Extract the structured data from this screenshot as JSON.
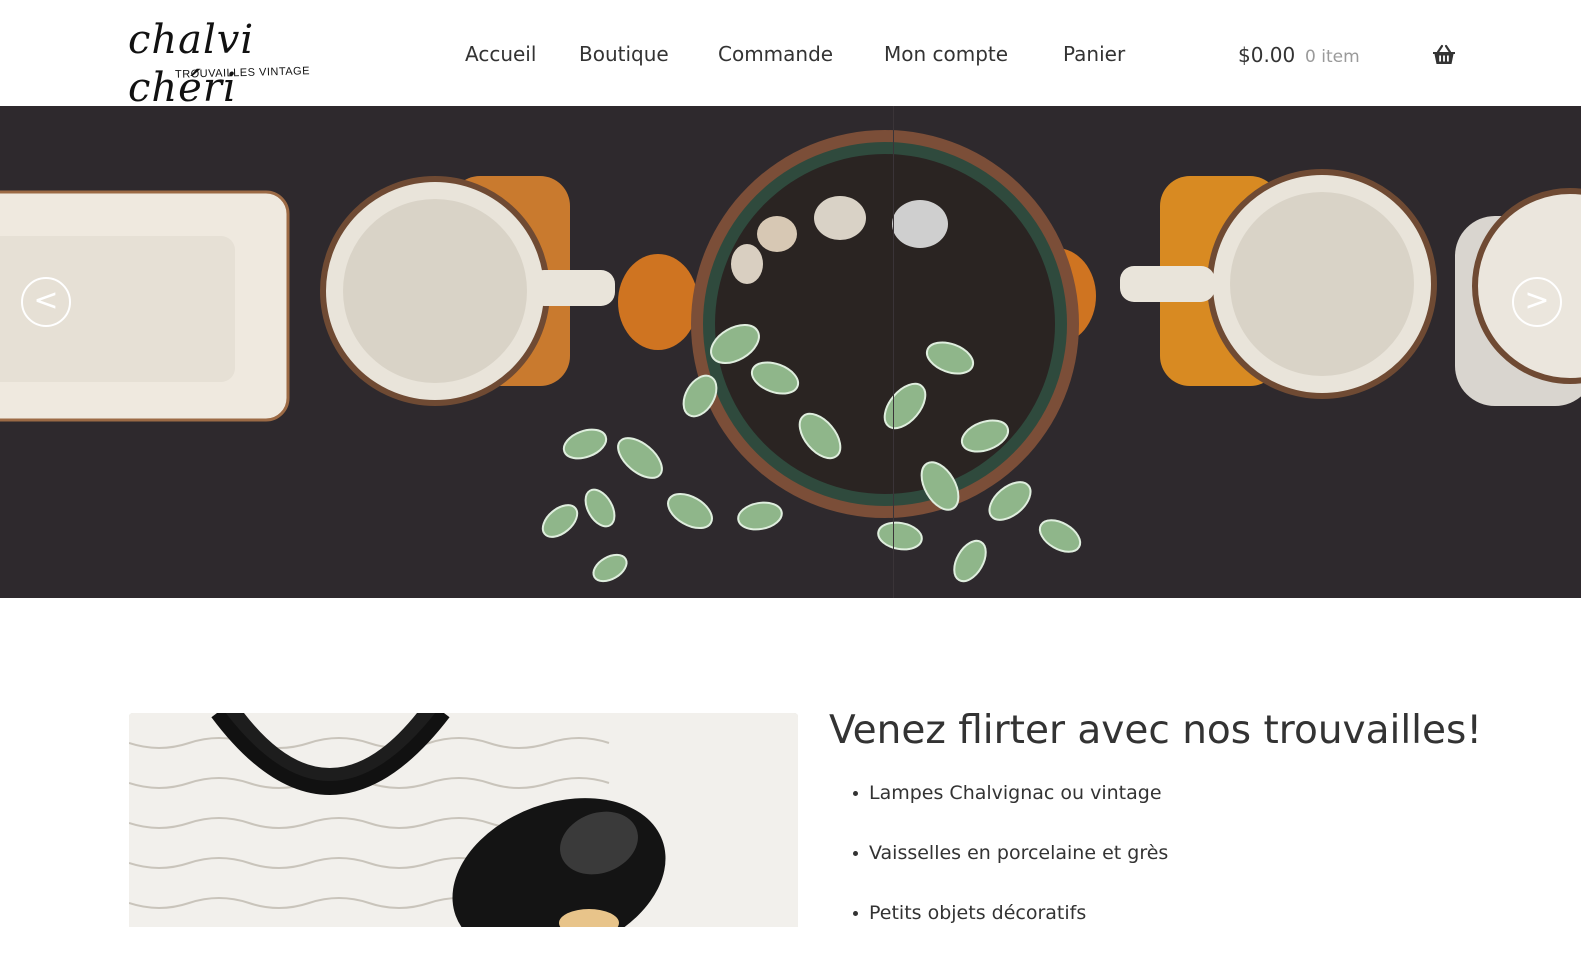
{
  "logo": {
    "script": "chalvi chéri",
    "tagline": "TROUVAILLES VINTAGE"
  },
  "nav": {
    "items": [
      {
        "label": "Accueil",
        "id": "accueil"
      },
      {
        "label": "Boutique",
        "id": "boutique"
      },
      {
        "label": "Commande",
        "id": "commande"
      },
      {
        "label": "Mon compte",
        "id": "mon-compte"
      },
      {
        "label": "Panier",
        "id": "panier"
      }
    ]
  },
  "cart": {
    "amount": "$0.00",
    "count": "0 item",
    "icon": "basket-icon"
  },
  "hero": {
    "prev_label": "<",
    "next_label": ">"
  },
  "content": {
    "headline": "Venez flirter avec nos trouvailles!",
    "features": [
      "Lampes Chalvignac ou vintage",
      "Vaisselles en porcelaine et grès",
      "Petits objets décoratifs"
    ]
  },
  "colors": {
    "text": "#333333",
    "muted": "#9a9a9a",
    "hero_bg": "#2e292d"
  }
}
